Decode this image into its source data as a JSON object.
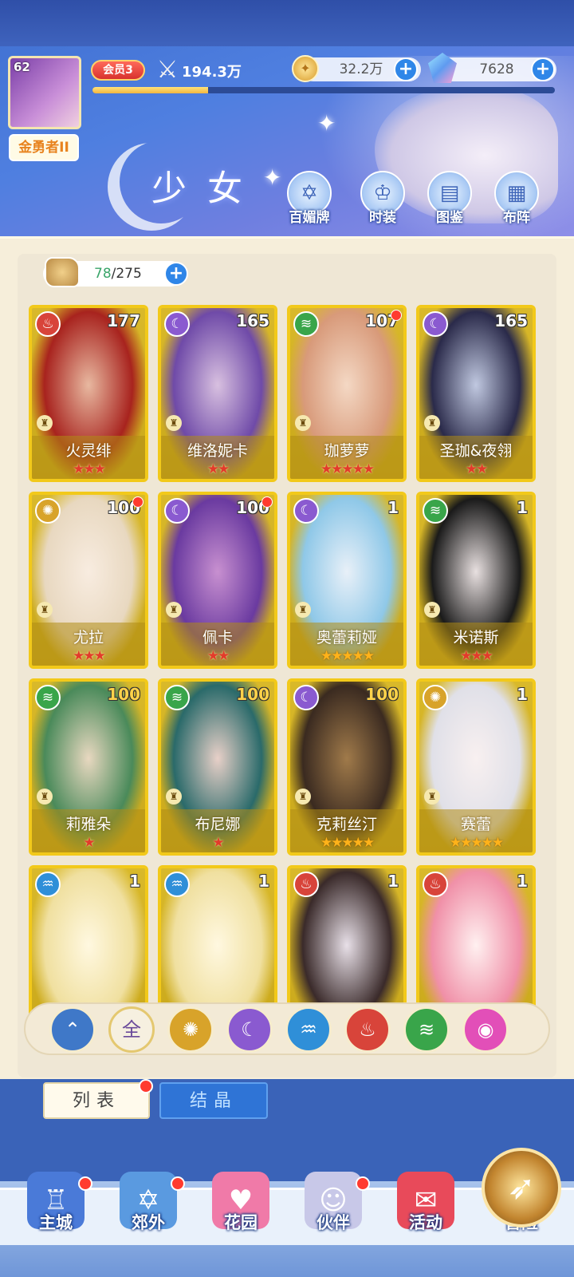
{
  "header": {
    "player_level": "62",
    "player_title": "金勇者II",
    "vip_label": "会员3",
    "power": "194.3万",
    "exp_fraction": 0.25,
    "gold": "32.2万",
    "gems": "7628"
  },
  "section_title": "少女",
  "nav_buttons": [
    {
      "label": "百媚牌",
      "icon": "card-icon"
    },
    {
      "label": "时装",
      "icon": "outfit-icon"
    },
    {
      "label": "图鉴",
      "icon": "book-icon"
    },
    {
      "label": "布阵",
      "icon": "grid-icon"
    }
  ],
  "roster": {
    "current": "78",
    "max": "/275"
  },
  "cards": [
    {
      "name": "火灵绯",
      "level": "177",
      "element": "fire",
      "stars": 3,
      "dot": false,
      "star_color": "red"
    },
    {
      "name": "维洛妮卡",
      "level": "165",
      "element": "moon",
      "stars": 2,
      "dot": false,
      "star_color": "red"
    },
    {
      "name": "珈萝萝",
      "level": "107",
      "element": "wind",
      "stars": 5,
      "dot": true,
      "star_color": "red"
    },
    {
      "name": "圣珈&夜翎",
      "level": "165",
      "element": "moon",
      "stars": 2,
      "dot": false,
      "star_color": "red"
    },
    {
      "name": "尤拉",
      "level": "100",
      "element": "sun",
      "stars": 3,
      "dot": true,
      "star_color": "red"
    },
    {
      "name": "佩卡",
      "level": "100",
      "element": "moon",
      "stars": 2,
      "dot": true,
      "star_color": "red"
    },
    {
      "name": "奥蕾莉娅",
      "level": "1",
      "element": "moon",
      "stars": 5,
      "dot": false,
      "star_color": "gold"
    },
    {
      "name": "米诺斯",
      "level": "1",
      "element": "wind",
      "stars": 3,
      "dot": false,
      "star_color": "red"
    },
    {
      "name": "莉雅朵",
      "level": "100",
      "element": "wind",
      "stars": 1,
      "dot": false,
      "star_color": "red",
      "gold_level": true
    },
    {
      "name": "布尼娜",
      "level": "100",
      "element": "wind",
      "stars": 1,
      "dot": false,
      "star_color": "red",
      "gold_level": true
    },
    {
      "name": "克莉丝汀",
      "level": "100",
      "element": "moon",
      "stars": 5,
      "dot": false,
      "star_color": "gold",
      "gold_level": true
    },
    {
      "name": "赛蕾",
      "level": "1",
      "element": "sun",
      "stars": 5,
      "dot": false,
      "star_color": "gold"
    },
    {
      "name": "",
      "level": "1",
      "element": "water",
      "stars": 0,
      "dot": false,
      "star_color": "red"
    },
    {
      "name": "",
      "level": "1",
      "element": "water",
      "stars": 0,
      "dot": false,
      "star_color": "red"
    },
    {
      "name": "",
      "level": "1",
      "element": "fire",
      "stars": 0,
      "dot": false,
      "star_color": "red"
    },
    {
      "name": "",
      "level": "1",
      "element": "fire",
      "stars": 0,
      "dot": false,
      "star_color": "red"
    }
  ],
  "filters": [
    {
      "icon": "collapse-icon",
      "label": "",
      "color": "#3f78c8"
    },
    {
      "icon": "all-icon",
      "label": "全",
      "color": "#f6f0e0"
    },
    {
      "icon": "sun-icon",
      "label": "",
      "color": "#d8a32a"
    },
    {
      "icon": "moon-icon",
      "label": "",
      "color": "#8a5ad0"
    },
    {
      "icon": "water-icon",
      "label": "",
      "color": "#2f8fd8"
    },
    {
      "icon": "fire-icon",
      "label": "",
      "color": "#d8443a"
    },
    {
      "icon": "wind-icon",
      "label": "",
      "color": "#39a54a"
    },
    {
      "icon": "heart-icon",
      "label": "",
      "color": "#e24fb8"
    }
  ],
  "tabs": [
    {
      "label": "列表",
      "dot": true
    },
    {
      "label": "结晶",
      "dot": false
    }
  ],
  "bottom_nav": [
    {
      "label": "主城",
      "dot": true,
      "icon": "castle-icon"
    },
    {
      "label": "郊外",
      "dot": true,
      "icon": "gate-icon"
    },
    {
      "label": "花园",
      "dot": false,
      "icon": "heart-icon"
    },
    {
      "label": "伙伴",
      "dot": true,
      "icon": "partner-icon"
    },
    {
      "label": "活动",
      "dot": false,
      "icon": "gift-icon"
    },
    {
      "label": "冒险",
      "dot": false,
      "icon": "compass-icon"
    }
  ]
}
